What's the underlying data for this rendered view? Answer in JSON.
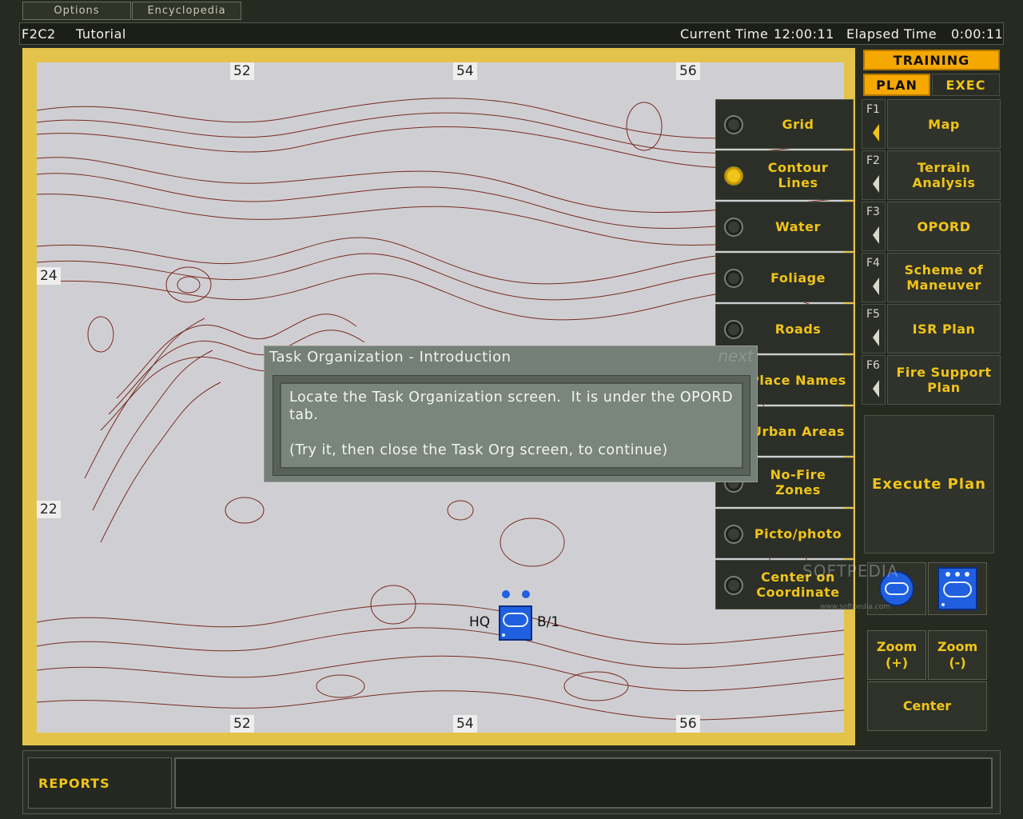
{
  "menu": {
    "options": "Options",
    "encyclopedia": "Encyclopedia"
  },
  "titlebar": {
    "app": "F2C2",
    "mode": "Tutorial",
    "current_time_label": "Current Time",
    "current_time": "12:00:11",
    "elapsed_time_label": "Elapsed Time",
    "elapsed_time": "0:00:11"
  },
  "map": {
    "grid_labels": {
      "top_left": "52",
      "top_mid": "54",
      "top_right": "56",
      "bottom_left": "52",
      "bottom_mid": "54",
      "bottom_right": "56",
      "left_upper": "24",
      "left_lower": "22"
    },
    "units": {
      "hq": "HQ",
      "b1": "B/1"
    }
  },
  "overlays": [
    {
      "label": "Grid",
      "on": false
    },
    {
      "label": "Contour Lines",
      "on": true
    },
    {
      "label": "Water",
      "on": false
    },
    {
      "label": "Foliage",
      "on": false
    },
    {
      "label": "Roads",
      "on": false
    },
    {
      "label": "Place Names",
      "on": false
    },
    {
      "label": "Urban Areas",
      "on": false
    },
    {
      "label": "No-Fire Zones",
      "on": false
    },
    {
      "label": "Picto/photo",
      "on": false
    },
    {
      "label": "Center on Coordinate",
      "on": false
    }
  ],
  "sidebar": {
    "training": "TRAINING",
    "plan": "PLAN",
    "exec": "EXEC",
    "fkeys": [
      {
        "key": "F1",
        "label": "Map"
      },
      {
        "key": "F2",
        "label": "Terrain Analysis"
      },
      {
        "key": "F3",
        "label": "OPORD"
      },
      {
        "key": "F4",
        "label": "Scheme of Maneuver"
      },
      {
        "key": "F5",
        "label": "ISR Plan"
      },
      {
        "key": "F6",
        "label": "Fire Support Plan"
      }
    ],
    "execute": "Execute Plan",
    "zoom_in": "Zoom (+)",
    "zoom_out": "Zoom (-)",
    "center": "Center",
    "watermark": "SOFTPEDIA",
    "watermark_url": "www.softpedia.com"
  },
  "dialog": {
    "title": "Task Organization - Introduction",
    "next": "next",
    "line1": "Locate the Task Organization screen.  It is under the OPORD tab.",
    "line2": "(Try it, then close the Task Org screen, to continue)"
  },
  "bottom": {
    "reports": "REPORTS"
  },
  "colors": {
    "accent": "#f0c419",
    "active": "#f5a800",
    "map_border": "#e3c34a",
    "contour": "#7a2a20"
  }
}
